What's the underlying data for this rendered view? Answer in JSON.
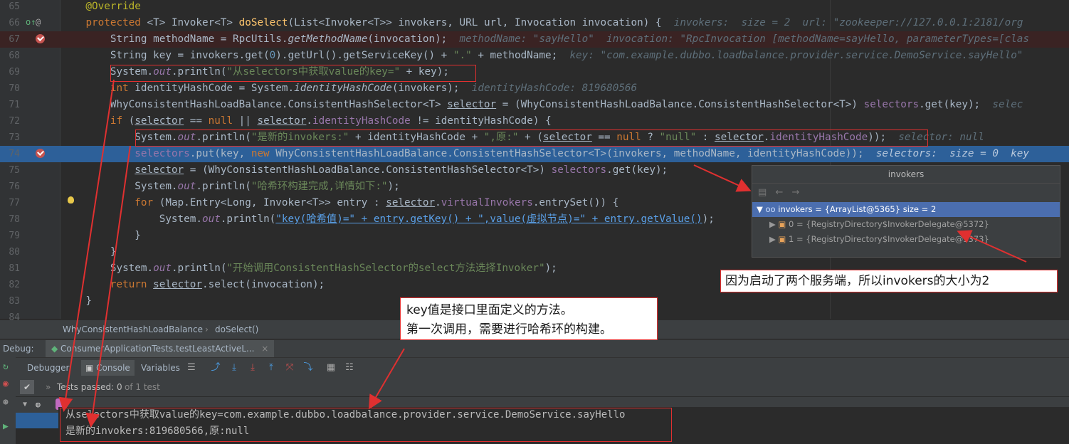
{
  "editor": {
    "lines": [
      {
        "n": "65",
        "html": "<span class=\"ann\">    @Override</span>"
      },
      {
        "n": "66",
        "html": "    <span class=\"kw\">protected</span> &lt;T&gt; Invoker&lt;T&gt; <span style=\"color:#ffc66d\">doSelect</span>(List&lt;Invoker&lt;T&gt;&gt; invokers, URL url, Invocation invocation) {  <span class=\"hint\">invokers:  size = 2  url: \"zookeeper://127.0.0.1:2181/org</span>"
      },
      {
        "n": "67",
        "html": "        String methodName = RpcUtils.<span class=\"stfn\">getMethodName</span>(invocation);  <span class=\"hint\">methodName: \"sayHello\"  invocation: \"RpcInvocation [methodName=sayHello, parameterTypes=[clas</span>"
      },
      {
        "n": "68",
        "html": "        String key = invokers.get(<span style=\"color:#6897bb\">0</span>).getUrl().getServiceKey() + <span class=\"str\">\".\"</span> + methodName;  <span class=\"hint\">key: \"com.example.dubbo.loadbalance.provider.service.DemoService.sayHello\"</span>"
      },
      {
        "n": "69",
        "html": "        System.<span class=\"fld it\">out</span>.println(<span class=\"str\">\"从selectors中获取value的key=\"</span> + key);"
      },
      {
        "n": "70",
        "html": "        <span class=\"kw\">int</span> identityHashCode = System.<span class=\"stfn\">identityHashCode</span>(invokers);  <span class=\"hint\">identityHashCode: 819680566</span>"
      },
      {
        "n": "71",
        "html": "        WhyConsistentHashLoadBalance.ConsistentHashSelector&lt;T&gt; <span class=\"ul\">selector</span> = (WhyConsistentHashLoadBalance.ConsistentHashSelector&lt;T&gt;) <span class=\"fld\">selectors</span>.get(key);  <span class=\"hint\">selec</span>"
      },
      {
        "n": "72",
        "html": "        <span class=\"kw\">if</span> (<span class=\"ul\">selector</span> == <span class=\"kw\">null</span> || <span class=\"ul\">selector</span>.<span class=\"fld\">identityHashCode</span> != identityHashCode) {"
      },
      {
        "n": "73",
        "html": "            System.<span class=\"fld it\">out</span>.println(<span class=\"str\">\"是新的invokers:\"</span> + identityHashCode + <span class=\"str\">\",原:\"</span> + (<span class=\"ul\">selector</span> == <span class=\"kw\">null</span> ? <span class=\"str\">\"null\"</span> : <span class=\"ul\">selector</span>.<span class=\"fld\">identityHashCode</span>));  <span class=\"hint\">selector: null</span>"
      },
      {
        "n": "74",
        "html": "            <span class=\"fld\">selectors</span>.put(key, <span class=\"kw\">new</span> WhyConsistentHashLoadBalance.ConsistentHashSelector&lt;T&gt;(invokers, methodName, identityHashCode));  <span class=\"hint\" style=\"color:#b8c8dc\">selectors:  size = 0  key</span>"
      },
      {
        "n": "75",
        "html": "            <span class=\"ul\">selector</span> = (WhyConsistentHashLoadBalance.ConsistentHashSelector&lt;T&gt;) <span class=\"fld\">selectors</span>.get(key);"
      },
      {
        "n": "76",
        "html": "            System.<span class=\"fld it\">out</span>.println(<span class=\"str\">\"哈希环构建完成,详情如下:\"</span>);"
      },
      {
        "n": "77",
        "html": "            <span class=\"kw\">for</span> (Map.Entry&lt;Long, Invoker&lt;T&gt;&gt; entry : <span class=\"ul\">selector</span>.<span class=\"fld\">virtualInvokers</span>.entrySet()) {"
      },
      {
        "n": "78",
        "html": "                System.<span class=\"fld it\">out</span>.println(<span class=\"str\" style=\"text-decoration:underline;color:#5aa0e8\">\"key(哈希值)=\" + entry.getKey() + \",value(虚拟节点)=\" + entry.getValue()</span>);"
      },
      {
        "n": "79",
        "html": "            }"
      },
      {
        "n": "80",
        "html": "        }"
      },
      {
        "n": "81",
        "html": "        System.<span class=\"fld it\">out</span>.println(<span class=\"str\">\"开始调用ConsistentHashSelector的select方法选择Invoker\"</span>);"
      },
      {
        "n": "82",
        "html": "        <span class=\"kw\">return</span> <span class=\"ul\">selector</span>.select(invocation);"
      },
      {
        "n": "83",
        "html": "    }"
      },
      {
        "n": "84",
        "html": ""
      }
    ]
  },
  "breadcrumb": {
    "class_name": "WhyConsistentHashLoadBalance",
    "method_name": "doSelect()"
  },
  "debug": {
    "label": "Debug:",
    "run_config": "ConsumerApplicationTests.testLeastActiveL...",
    "tabs": {
      "debugger": "Debugger",
      "console": "Console",
      "variables": "Variables"
    },
    "tests_passed": "Tests passed: 0",
    "tests_total": "of 1 test"
  },
  "console": {
    "line1": "从selectors中获取value的key=com.example.dubbo.loadbalance.provider.service.DemoService.sayHello",
    "line2": "是新的invokers:819680566,原:null"
  },
  "popup": {
    "title": "invokers",
    "root": "invokers = {ArrayList@5365}  size = 2",
    "item0": "0 = {RegistryDirectory$InvokerDelegate@5372}",
    "item1": "1 = {RegistryDirectory$InvokerDelegate@5373}"
  },
  "callouts": {
    "right": "因为启动了两个服务端，所以invokers的大小为2",
    "mid_line1": "key值是接口里面定义的方法。",
    "mid_line2": "第一次调用，需要进行哈希环的构建。"
  },
  "colors": {
    "annotation_red": "#e03030",
    "selection_blue": "#2d6099"
  }
}
